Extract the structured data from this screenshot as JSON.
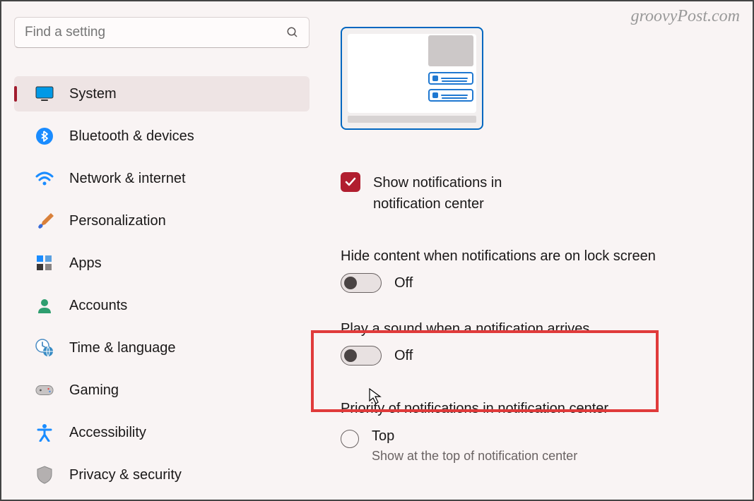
{
  "watermark": "groovyPost.com",
  "search": {
    "placeholder": "Find a setting"
  },
  "sidebar": {
    "items": [
      {
        "label": "System",
        "icon": "monitor"
      },
      {
        "label": "Bluetooth & devices",
        "icon": "bluetooth"
      },
      {
        "label": "Network & internet",
        "icon": "wifi"
      },
      {
        "label": "Personalization",
        "icon": "brush"
      },
      {
        "label": "Apps",
        "icon": "apps"
      },
      {
        "label": "Accounts",
        "icon": "person"
      },
      {
        "label": "Time & language",
        "icon": "clock"
      },
      {
        "label": "Gaming",
        "icon": "gamepad"
      },
      {
        "label": "Accessibility",
        "icon": "accessibility"
      },
      {
        "label": "Privacy & security",
        "icon": "shield"
      }
    ],
    "selected_index": 0
  },
  "main": {
    "checkbox": {
      "label_line1": "Show notifications in",
      "label_line2": "notification center",
      "checked": true
    },
    "hide_content": {
      "title": "Hide content when notifications are on lock screen",
      "state": "Off"
    },
    "play_sound": {
      "title": "Play a sound when a notification arrives",
      "state": "Off"
    },
    "priority": {
      "title": "Priority of notifications in notification center"
    },
    "radio_top": {
      "label": "Top",
      "sub": "Show at the top of notification center"
    }
  }
}
